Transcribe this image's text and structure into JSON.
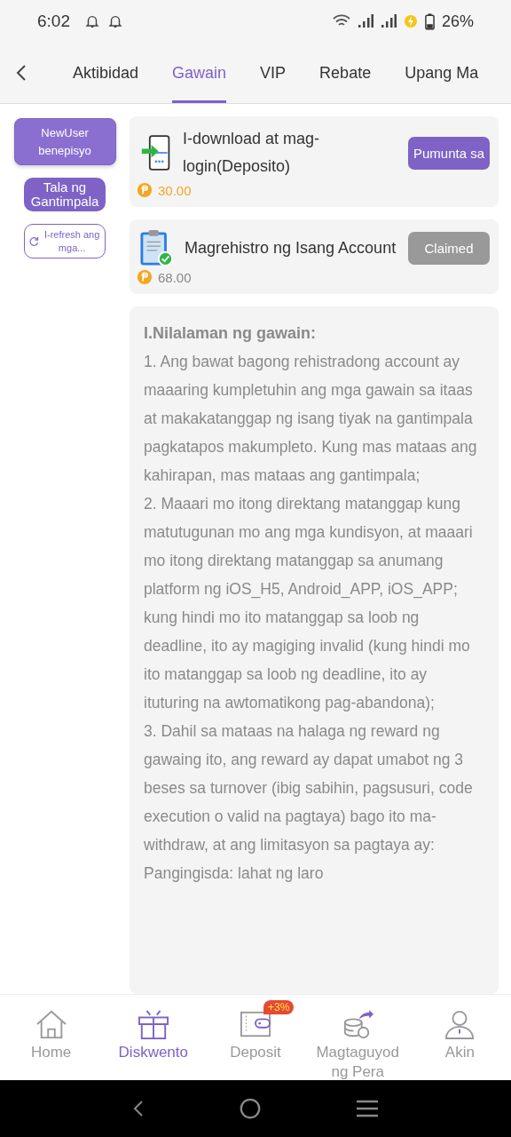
{
  "status_bar": {
    "time": "6:02",
    "battery": "26%"
  },
  "tabs": [
    {
      "label": "Aktibidad",
      "selected": false
    },
    {
      "label": "Gawain",
      "selected": true
    },
    {
      "label": "VIP",
      "selected": false
    },
    {
      "label": "Rebate",
      "selected": false
    },
    {
      "label": "Upang Ma",
      "selected": false
    }
  ],
  "sidebar": {
    "categories": [
      {
        "label": "NewUser benepisyo",
        "selected": true
      }
    ],
    "record_button": "Tala ng Gantimpala",
    "refresh_button": "I-refresh ang mga..."
  },
  "tasks": [
    {
      "title": "I-download at mag-login(Deposito)",
      "reward": "30.00",
      "button": "Pumunta sa",
      "claimed": false
    },
    {
      "title": "Magrehistro ng Isang Account",
      "reward": "68.00",
      "button": "Claimed",
      "claimed": true
    }
  ],
  "description": {
    "heading": "I.Nilalaman ng gawain:",
    "paragraphs": [
      "1. Ang bawat bagong rehistradong account ay maaaring kumpletuhin ang mga gawain sa itaas at makakatanggap ng isang tiyak na gantimpala pagkatapos makumpleto. Kung mas mataas ang kahirapan, mas mataas ang gantimpala;",
      "2. Maaari mo itong direktang matanggap kung matutugunan mo ang mga kundisyon, at maaari mo itong direktang matanggap sa anumang platform ng iOS_H5, Android_APP, iOS_APP; kung hindi mo ito matanggap sa loob ng deadline, ito ay magiging invalid (kung hindi mo ito matanggap sa loob ng deadline, ito ay ituturing na awtomatikong pag-abandona);",
      "3. Dahil sa mataas na halaga ng reward ng gawaing ito, ang reward ay dapat umabot ng 3 beses sa turnover (ibig sabihin, pagsusuri, code execution o valid na pagtaya) bago ito ma-withdraw, at ang limitasyon sa pagtaya ay:",
      "Pangingisda: lahat ng laro"
    ]
  },
  "bottom_nav": [
    {
      "label": "Home",
      "selected": false
    },
    {
      "label": "Diskwento",
      "selected": true
    },
    {
      "label": "Deposit",
      "selected": false,
      "badge": "+3%"
    },
    {
      "label": "Magtaguyod ng Pera",
      "selected": false
    },
    {
      "label": "Akin",
      "selected": false
    }
  ]
}
